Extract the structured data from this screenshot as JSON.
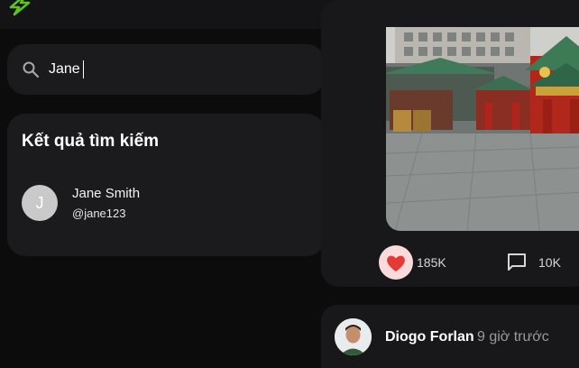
{
  "nav": {
    "logo_icon": "lightning-icon",
    "home_icon": "home-icon",
    "profile_icon": "user-icon",
    "accent_color": "#5ec41d"
  },
  "search": {
    "icon": "search-icon",
    "value": "Jane"
  },
  "results": {
    "title": "Kết quả tìm kiếm",
    "items": [
      {
        "avatar_letter": "J",
        "name": "Jane Smith",
        "handle": "@jane123"
      }
    ]
  },
  "post": {
    "likes": "185K",
    "comments": "10K",
    "like_icon": "heart-icon",
    "comment_icon": "comment-icon"
  },
  "post2": {
    "author": "Diogo Forlan",
    "time": "9 giờ trước"
  }
}
